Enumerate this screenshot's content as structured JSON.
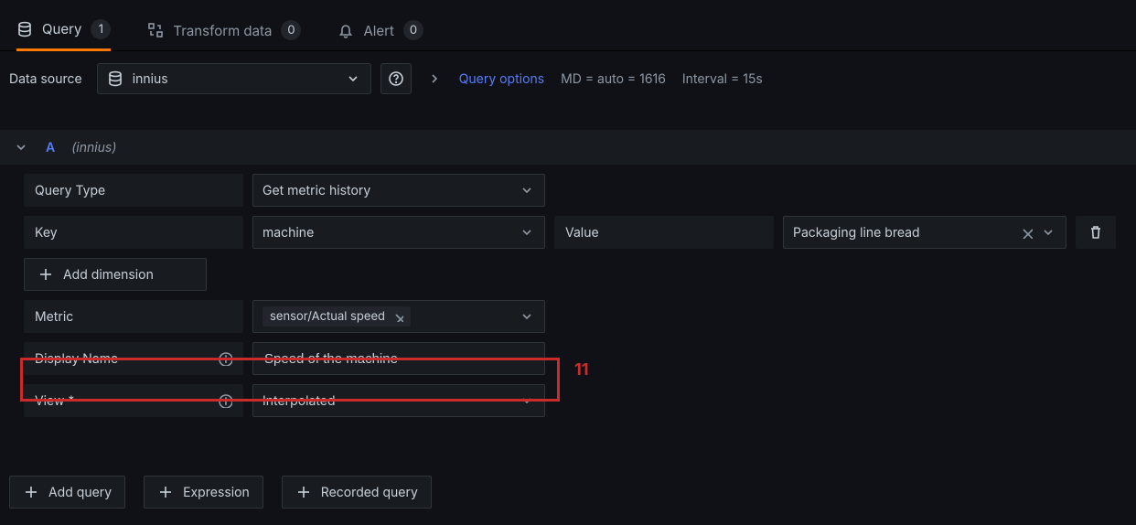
{
  "tabs": {
    "query": {
      "label": "Query",
      "count": "1"
    },
    "transform": {
      "label": "Transform data",
      "count": "0"
    },
    "alert": {
      "label": "Alert",
      "count": "0"
    }
  },
  "dsbar": {
    "label": "Data source",
    "selected": "innius",
    "query_options": "Query options",
    "md": "MD = auto = 1616",
    "interval": "Interval = 15s"
  },
  "query": {
    "letter": "A",
    "ds": "(innius)"
  },
  "labels": {
    "query_type": "Query Type",
    "key": "Key",
    "value": "Value",
    "metric": "Metric",
    "display_name": "Display Name",
    "view": "View *"
  },
  "values": {
    "query_type": "Get metric history",
    "key": "machine",
    "value": "Packaging line bread",
    "metric_chip": "sensor/Actual speed",
    "display_name": "Speed of the machine",
    "view": "Interpolated"
  },
  "buttons": {
    "add_dimension": "Add dimension",
    "add_query": "Add query",
    "expression": "Expression",
    "recorded_query": "Recorded query"
  },
  "annotation": {
    "num": "11"
  }
}
